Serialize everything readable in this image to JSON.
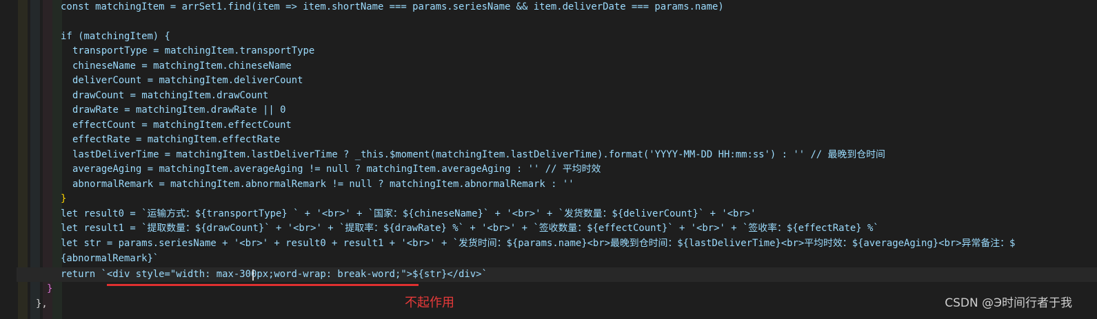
{
  "editor": {
    "lines": [
      {
        "id": "l0",
        "text": "const matchingItem = arrSet1.find(item => item.shortName === params.seriesName && item.deliverDate === params.name)"
      },
      {
        "id": "l1",
        "text": ""
      },
      {
        "id": "l2",
        "text": "if (matchingItem) {"
      },
      {
        "id": "l3",
        "text": "transportType = matchingItem.transportType"
      },
      {
        "id": "l4",
        "text": "chineseName = matchingItem.chineseName"
      },
      {
        "id": "l5",
        "text": "deliverCount = matchingItem.deliverCount"
      },
      {
        "id": "l6",
        "text": "drawCount = matchingItem.drawCount"
      },
      {
        "id": "l7",
        "text": "drawRate = matchingItem.drawRate || 0"
      },
      {
        "id": "l8",
        "text": "effectCount = matchingItem.effectCount"
      },
      {
        "id": "l9",
        "text": "effectRate = matchingItem.effectRate"
      },
      {
        "id": "l10",
        "text": "lastDeliverTime = matchingItem.lastDeliverTime ? _this.$moment(matchingItem.lastDeliverTime).format('YYYY-MM-DD HH:mm:ss') : '' // 最晚到仓时间"
      },
      {
        "id": "l11",
        "text": "averageAging = matchingItem.averageAging != null ? matchingItem.averageAging : '' // 平均时效"
      },
      {
        "id": "l12",
        "text": "abnormalRemark = matchingItem.abnormalRemark != null ? matchingItem.abnormalRemark : ''"
      },
      {
        "id": "l13",
        "text": "}"
      },
      {
        "id": "l14",
        "text": "let result0 = `运输方式：${transportType} ` + '<br>' + `国家：${chineseName}` + '<br>' + `发货数量：${deliverCount}` + '<br>'"
      },
      {
        "id": "l15",
        "text": "let result1 = `提取数量：${drawCount}` + '<br>' + `提取率：${drawRate} %` + '<br>' + `签收数量：${effectCount}` + '<br>' + `签收率：${effectRate} %`"
      },
      {
        "id": "l16",
        "text": "let str = params.seriesName + '<br>' + result0 + result1 + '<br>' + `发货时间：${params.name}<br>最晚到仓时间：${lastDeliverTime}<br>平均时效：${averageAging}<br>异常备注：$"
      },
      {
        "id": "l17",
        "text": "{abnormalRemark}`"
      },
      {
        "id": "l18",
        "text": "return `<div style=\"width: max-300px;word-wrap: break-word;\">${str}</div>`"
      },
      {
        "id": "l19",
        "text": "}"
      },
      {
        "id": "l20",
        "text": "},"
      }
    ]
  },
  "annotation": {
    "label": "不起作用",
    "color": "#e83a3a"
  },
  "watermark": {
    "text": "CSDN @Э时间行者于我"
  },
  "colors": {
    "background": "#1e1e1e",
    "keyword": "#569cd6",
    "control": "#c586c0",
    "variable": "#9cdcfe",
    "function": "#dcdcaa",
    "string": "#ce9178",
    "comment": "#6a9955",
    "number": "#b5cea8"
  }
}
